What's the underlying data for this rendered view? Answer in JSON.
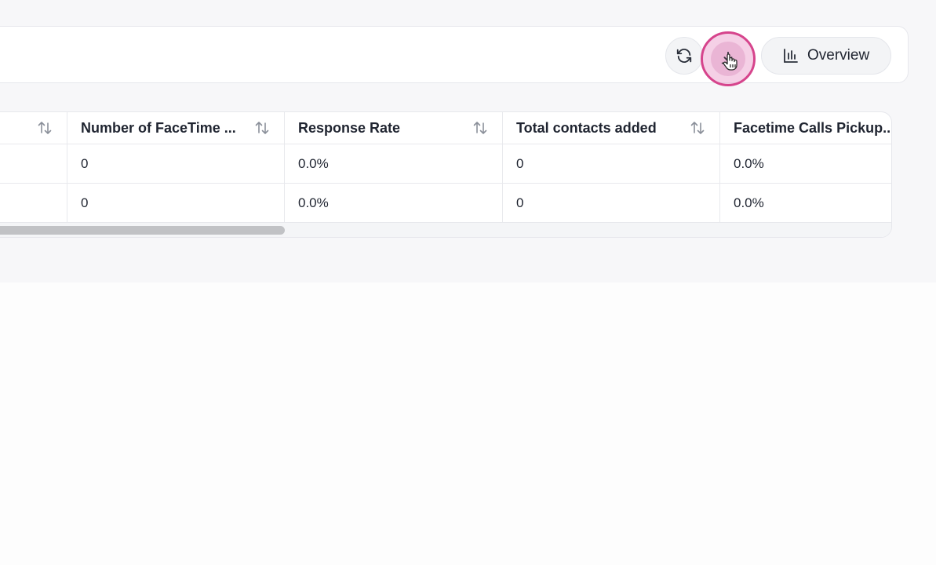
{
  "toolbar": {
    "refresh_icon": "refresh-icon",
    "download_icon": "download-icon",
    "overview_label": "Overview",
    "overview_icon": "bar-chart-icon"
  },
  "table": {
    "headers": [
      "",
      "Number of FaceTime ...",
      "Response Rate",
      "Total contacts added",
      "Facetime Calls Pickup.."
    ],
    "rows": [
      [
        "",
        "0",
        "0.0%",
        "0",
        "0.0%"
      ],
      [
        "",
        "0",
        "0.0%",
        "0",
        "0.0%"
      ]
    ],
    "scroll_fraction": 0.33
  },
  "colors": {
    "highlight_ring": "#d6448c",
    "highlight_fill": "#e896c8"
  }
}
